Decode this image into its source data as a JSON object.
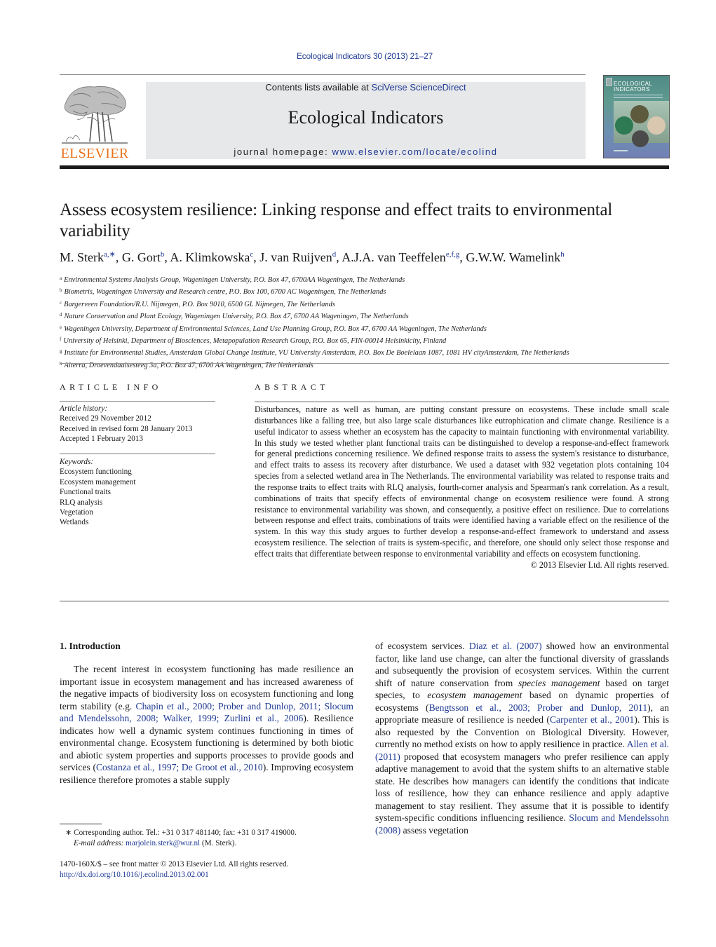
{
  "journal_ref": "Ecological Indicators 30 (2013) 21–27",
  "masthead": {
    "contents_prefix": "Contents lists available at ",
    "contents_link": "SciVerse ScienceDirect",
    "journal_name": "Ecological Indicators",
    "homepage_prefix": "journal homepage: ",
    "homepage_link": "www.elsevier.com/locate/ecolind",
    "publisher_logo": "ELSEVIER",
    "cover_title_1": "ECOLOGICAL",
    "cover_title_2": "INDICATORS"
  },
  "colors": {
    "link": "#1f3a93",
    "elsevier_orange": "#e9711c",
    "masthead_bg": "#e7e8ea"
  },
  "article": {
    "title": "Assess ecosystem resilience: Linking response and effect traits to environmental variability",
    "authors": [
      {
        "name": "M. Sterk",
        "sup": "a,∗"
      },
      {
        "name": "G. Gort",
        "sup": "b"
      },
      {
        "name": "A. Klimkowska",
        "sup": "c"
      },
      {
        "name": "J. van Ruijven",
        "sup": "d"
      },
      {
        "name": "A.J.A. van Teeffelen",
        "sup": "e,f,g"
      },
      {
        "name": "G.W.W. Wamelink",
        "sup": "h"
      }
    ],
    "affiliations": [
      {
        "key": "a",
        "text": "Environmental Systems Analysis Group, Wageningen University, P.O. Box 47, 6700AA Wageningen, The Netherlands"
      },
      {
        "key": "b",
        "text": "Biometris, Wageningen University and Research centre, P.O. Box 100, 6700 AC Wageningen, The Netherlands"
      },
      {
        "key": "c",
        "text": "Bargerveen Foundation/R.U. Nijmegen, P.O. Box 9010, 6500 GL Nijmegen, The Netherlands"
      },
      {
        "key": "d",
        "text": "Nature Conservation and Plant Ecology, Wageningen University, P.O. Box 47, 6700 AA Wageningen, The Netherlands"
      },
      {
        "key": "e",
        "text": "Wageningen University, Department of Environmental Sciences, Land Use Planning Group, P.O. Box 47, 6700 AA Wageningen, The Netherlands"
      },
      {
        "key": "f",
        "text": "University of Helsinki, Department of Biosciences, Metapopulation Research Group, P.O. Box 65, FIN-00014 Helsinkicity, Finland"
      },
      {
        "key": "g",
        "text": "Institute for Environmental Studies, Amsterdam Global Change Institute, VU University Amsterdam, P.O. Box De Boelelaan 1087, 1081 HV cityAmsterdam, The Netherlands"
      },
      {
        "key": "h",
        "text": "Alterra, Droevendaalsesteeg 3a, P.O. Box 47, 6700 AA Wageningen, The Netherlands"
      }
    ]
  },
  "article_info": {
    "heading": "ARTICLE INFO",
    "history_label": "Article history:",
    "history": [
      "Received 29 November 2012",
      "Received in revised form 28 January 2013",
      "Accepted 1 February 2013"
    ],
    "keywords_label": "Keywords:",
    "keywords": [
      "Ecosystem functioning",
      "Ecosystem management",
      "Functional traits",
      "RLQ analysis",
      "Vegetation",
      "Wetlands"
    ]
  },
  "abstract": {
    "heading": "ABSTRACT",
    "text": "Disturbances, nature as well as human, are putting constant pressure on ecosystems. These include small scale disturbances like a falling tree, but also large scale disturbances like eutrophication and climate change. Resilience is a useful indicator to assess whether an ecosystem has the capacity to maintain functioning with environmental variability. In this study we tested whether plant functional traits can be distinguished to develop a response-and-effect framework for general predictions concerning resilience. We defined response traits to assess the system's resistance to disturbance, and effect traits to assess its recovery after disturbance. We used a dataset with 932 vegetation plots containing 104 species from a selected wetland area in The Netherlands. The environmental variability was related to response traits and the response traits to effect traits with RLQ analysis, fourth-corner analysis and Spearman's rank correlation. As a result, combinations of traits that specify effects of environmental change on ecosystem resilience were found. A strong resistance to environmental variability was shown, and consequently, a positive effect on resilience. Due to correlations between response and effect traits, combinations of traits were identified having a variable effect on the resilience of the system. In this way this study argues to further develop a response-and-effect framework to understand and assess ecosystem resilience. The selection of traits is system-specific, and therefore, one should only select those response and effect traits that differentiate between response to environmental variability and effects on ecosystem functioning.",
    "copyright": "© 2013 Elsevier Ltd. All rights reserved."
  },
  "body": {
    "section_heading": "1.  Introduction",
    "left": [
      {
        "t": "The recent interest in ecosystem functioning has made resilience an important issue in ecosystem management and has increased awareness of the negative impacts of biodiversity loss on ecosystem functioning and long term stability (e.g. "
      },
      {
        "link": "Chapin et al., 2000; Prober and Dunlop, 2011; Slocum and Mendelssohn, 2008; Walker, 1999; Zurlini et al., 2006"
      },
      {
        "t": "). Resilience indicates how well a dynamic system continues functioning in times of environmental change. Ecosystem functioning is determined by both biotic and abiotic system properties and supports processes to provide goods and services ("
      },
      {
        "link": "Costanza et al., 1997; De Groot et al., 2010"
      },
      {
        "t": "). Improving ecosystem resilience therefore promotes a stable supply"
      }
    ],
    "right": [
      {
        "t": "of ecosystem services. "
      },
      {
        "link": "Diaz et al. (2007)"
      },
      {
        "t": " showed how an environmental factor, like land use change, can alter the functional diversity of grasslands and subsequently the provision of ecosystem services. Within the current shift of nature conservation from "
      },
      {
        "em": "species management"
      },
      {
        "t": " based on target species, to "
      },
      {
        "em": "ecosystem management"
      },
      {
        "t": " based on dynamic properties of ecosystems ("
      },
      {
        "link": "Bengtsson et al., 2003; Prober and Dunlop, 2011"
      },
      {
        "t": "), an appropriate measure of resilience is needed ("
      },
      {
        "link": "Carpenter et al., 2001"
      },
      {
        "t": "). This is also requested by the Convention on Biological Diversity. However, currently no method exists on how to apply resilience in practice. "
      },
      {
        "link": "Allen et al. (2011)"
      },
      {
        "t": " proposed that ecosystem managers who prefer resilience can apply adaptive management to avoid that the system shifts to an alternative stable state. He describes how managers can identify the conditions that indicate loss of resilience, how they can enhance resilience and apply adaptive management to stay resilient. They assume that it is possible to identify system-specific conditions influencing resilience. "
      },
      {
        "link": "Slocum and Mendelssohn (2008)"
      },
      {
        "t": " assess vegetation"
      }
    ]
  },
  "footnote": {
    "marker": "∗",
    "corresponding": "Corresponding author. Tel.: +31 0 317 481140; fax: +31 0 317 419000.",
    "email_label": "E-mail address:",
    "email": "marjolein.sterk@wur.nl",
    "email_suffix": " (M. Sterk)."
  },
  "front_matter": {
    "issn_line": "1470-160X/$ – see front matter © 2013 Elsevier Ltd. All rights reserved.",
    "doi": "http://dx.doi.org/10.1016/j.ecolind.2013.02.001"
  }
}
